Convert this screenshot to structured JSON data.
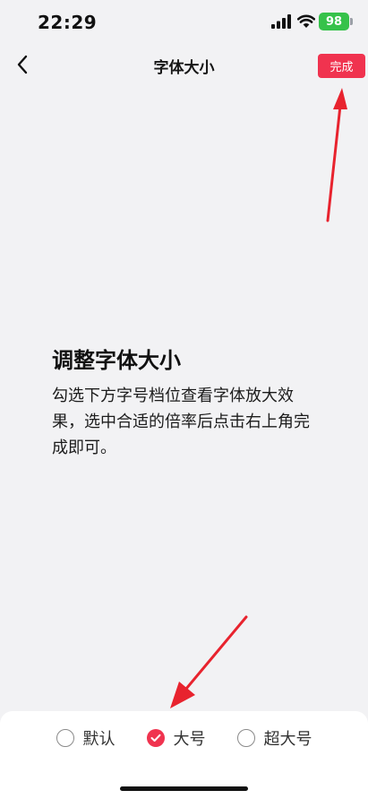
{
  "status_bar": {
    "time": "22:29",
    "battery": "98",
    "battery_color": "#36c24a",
    "icons": [
      "signal-icon",
      "wifi-icon",
      "battery-icon"
    ]
  },
  "nav": {
    "back_icon": "chevron-left-icon",
    "title": "字体大小",
    "done_label": "完成"
  },
  "content": {
    "heading": "调整字体大小",
    "description": "勾选下方字号档位查看字体放大效果，选中合适的倍率后点击右上角完成即可。"
  },
  "font_options": [
    {
      "label": "默认",
      "selected": false
    },
    {
      "label": "大号",
      "selected": true
    },
    {
      "label": "超大号",
      "selected": false
    }
  ],
  "accent_color": "#f0334f",
  "annotation_color": "#e8232e"
}
